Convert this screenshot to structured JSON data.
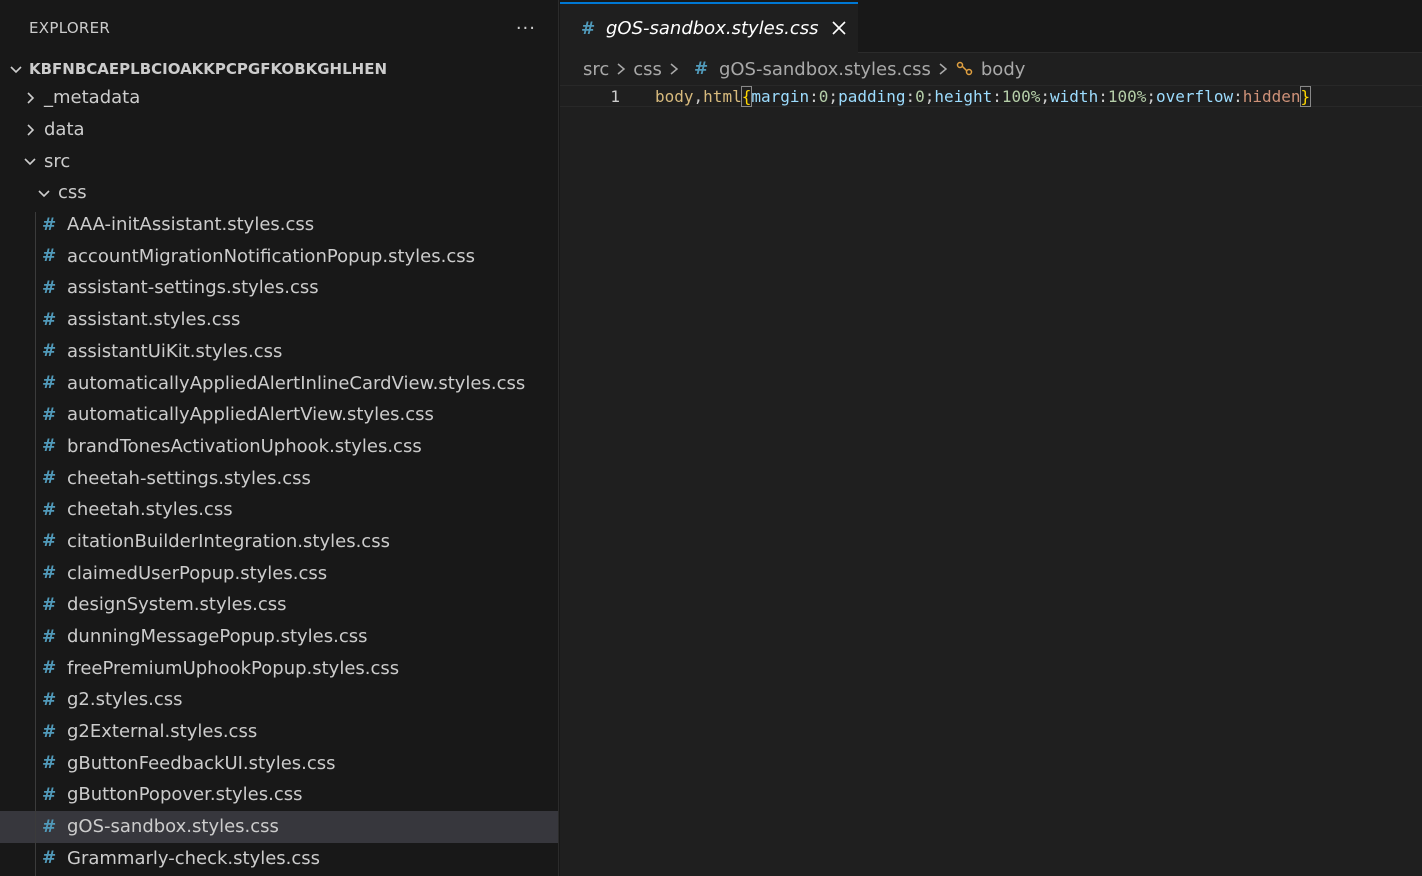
{
  "sidebar": {
    "title": "EXPLORER",
    "more_actions": "···",
    "workspace": "KBFNBCAEPLBCIOAKKPCPGFKOBKGHLHEN",
    "folders": [
      {
        "label": "_metadata",
        "expanded": false
      },
      {
        "label": "data",
        "expanded": false
      },
      {
        "label": "src",
        "expanded": true
      },
      {
        "label": "css",
        "expanded": true
      }
    ],
    "files": [
      "AAA-initAssistant.styles.css",
      "accountMigrationNotificationPopup.styles.css",
      "assistant-settings.styles.css",
      "assistant.styles.css",
      "assistantUiKit.styles.css",
      "automaticallyAppliedAlertInlineCardView.styles.css",
      "automaticallyAppliedAlertView.styles.css",
      "brandTonesActivationUphook.styles.css",
      "cheetah-settings.styles.css",
      "cheetah.styles.css",
      "citationBuilderIntegration.styles.css",
      "claimedUserPopup.styles.css",
      "designSystem.styles.css",
      "dunningMessagePopup.styles.css",
      "freePremiumUphookPopup.styles.css",
      "g2.styles.css",
      "g2External.styles.css",
      "gButtonFeedbackUI.styles.css",
      "gButtonPopover.styles.css",
      "gOS-sandbox.styles.css",
      "Grammarly-check.styles.css"
    ],
    "selected_file": "gOS-sandbox.styles.css",
    "file_icon": "#"
  },
  "editor": {
    "tab": {
      "label": "gOS-sandbox.styles.css",
      "icon": "#"
    },
    "breadcrumb": [
      "src",
      "css",
      "gOS-sandbox.styles.css",
      "body"
    ],
    "line_number": "1",
    "code_tokens": [
      {
        "t": "body",
        "c": "t-sel"
      },
      {
        "t": ",",
        "c": "t-punc"
      },
      {
        "t": "html",
        "c": "t-sel"
      },
      {
        "t": "{",
        "c": "t-brace"
      },
      {
        "t": "margin",
        "c": "t-prop"
      },
      {
        "t": ":",
        "c": "t-punc"
      },
      {
        "t": "0",
        "c": "t-num"
      },
      {
        "t": ";",
        "c": "t-punc"
      },
      {
        "t": "padding",
        "c": "t-prop"
      },
      {
        "t": ":",
        "c": "t-punc"
      },
      {
        "t": "0",
        "c": "t-num"
      },
      {
        "t": ";",
        "c": "t-punc"
      },
      {
        "t": "height",
        "c": "t-prop"
      },
      {
        "t": ":",
        "c": "t-punc"
      },
      {
        "t": "100%",
        "c": "t-num"
      },
      {
        "t": ";",
        "c": "t-punc"
      },
      {
        "t": "width",
        "c": "t-prop"
      },
      {
        "t": ":",
        "c": "t-punc"
      },
      {
        "t": "100%",
        "c": "t-num"
      },
      {
        "t": ";",
        "c": "t-punc"
      },
      {
        "t": "overflow",
        "c": "t-prop"
      },
      {
        "t": ":",
        "c": "t-punc"
      },
      {
        "t": "hidden",
        "c": "t-val"
      },
      {
        "t": "}",
        "c": "t-brace"
      }
    ]
  },
  "colors": {
    "accent": "#0078d4",
    "css_icon": "#519aba",
    "selection": "#37373d"
  }
}
